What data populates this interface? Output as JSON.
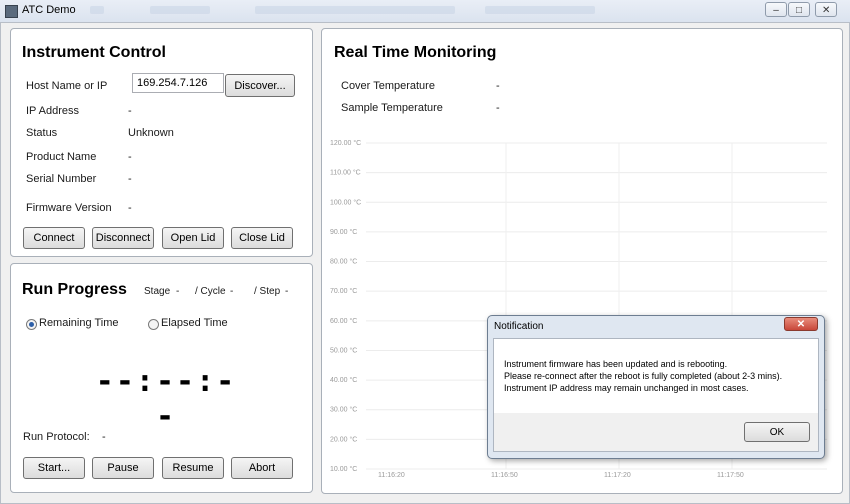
{
  "window": {
    "title": "ATC Demo",
    "controls": {
      "minimize": "–",
      "restore": "□",
      "close": "✕"
    }
  },
  "instrument": {
    "title": "Instrument Control",
    "host_label": "Host Name or IP",
    "host_value": "169.254.7.126",
    "discover": "Discover...",
    "ip_label": "IP Address",
    "ip_value": "-",
    "status_label": "Status",
    "status_value": "Unknown",
    "product_label": "Product Name",
    "product_value": "-",
    "serial_label": "Serial Number",
    "serial_value": "-",
    "firmware_label": "Firmware Version",
    "firmware_value": "-",
    "buttons": {
      "connect": "Connect",
      "disconnect": "Disconnect",
      "open_lid": "Open Lid",
      "close_lid": "Close Lid"
    }
  },
  "run": {
    "title": "Run Progress",
    "stage_label": "Stage",
    "stage_value": "-",
    "cycle_label": "/ Cycle",
    "cycle_value": "-",
    "step_label": "/ Step",
    "step_value": "-",
    "remaining": "Remaining Time",
    "elapsed": "Elapsed Time",
    "selected_mode": "remaining",
    "timer": "--:--:--",
    "protocol_label": "Run Protocol:",
    "protocol_value": "-",
    "buttons": {
      "start": "Start...",
      "pause": "Pause",
      "resume": "Resume",
      "abort": "Abort"
    }
  },
  "monitor": {
    "title": "Real Time Monitoring",
    "cover_label": "Cover Temperature",
    "cover_value": "-",
    "sample_label": "Sample Temperature",
    "sample_value": "-"
  },
  "chart_data": {
    "type": "line",
    "y_ticks": [
      "120.00 °C",
      "110.00 °C",
      "100.00 °C",
      "90.00 °C",
      "80.00 °C",
      "70.00 °C",
      "60.00 °C",
      "50.00 °C",
      "40.00 °C",
      "30.00 °C",
      "20.00 °C",
      "10.00 °C"
    ],
    "x_ticks": [
      "11:16:20",
      "11:16:50",
      "11:17:20",
      "11:17:50"
    ],
    "ylim": [
      10,
      120
    ],
    "grid": true,
    "series": []
  },
  "dialog": {
    "title": "Notification",
    "close": "✕",
    "lines": [
      "Instrument firmware has been updated and is rebooting.",
      "Please re-connect after the reboot is fully completed (about 2-3 mins).",
      "Instrument IP address may remain unchanged in most cases."
    ],
    "ok": "OK"
  }
}
